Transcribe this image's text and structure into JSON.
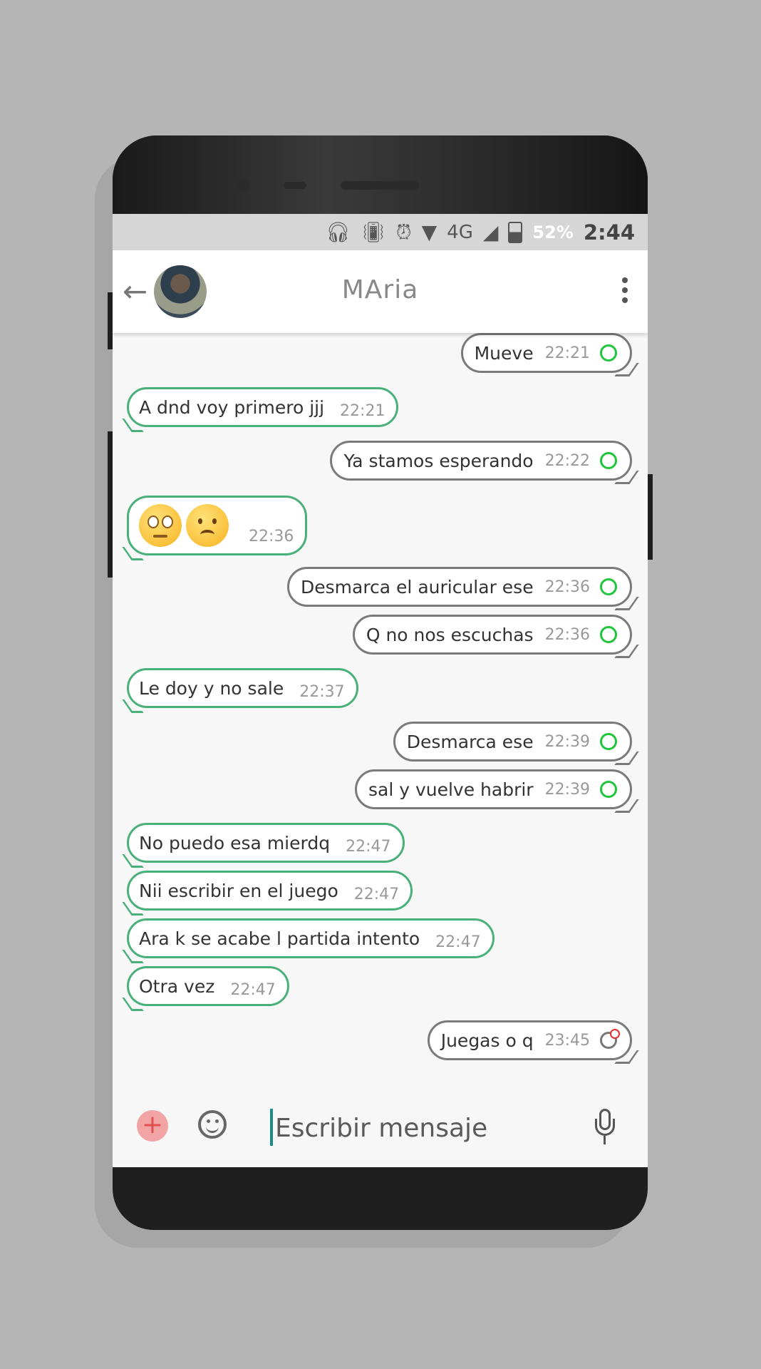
{
  "statusbar": {
    "network": "4G",
    "battery": "52%",
    "time": "2:44"
  },
  "header": {
    "contact_name": "MAria"
  },
  "messages": [
    {
      "dir": "out",
      "text": "Mueve",
      "time": "22:21",
      "status": "sent"
    },
    {
      "dir": "in",
      "text": "A dnd voy primero jjj",
      "time": "22:21"
    },
    {
      "dir": "out",
      "text": "Ya stamos esperando",
      "time": "22:22",
      "status": "sent"
    },
    {
      "dir": "in",
      "text": "",
      "emoji": [
        "eye-roll-emoji",
        "frowning-face-emoji"
      ],
      "time": "22:36"
    },
    {
      "dir": "out",
      "text": "Desmarca el auricular ese",
      "time": "22:36",
      "status": "sent"
    },
    {
      "dir": "out",
      "text": "Q no nos escuchas",
      "time": "22:36",
      "status": "sent"
    },
    {
      "dir": "in",
      "text": "Le doy y no sale",
      "time": "22:37"
    },
    {
      "dir": "out",
      "text": "Desmarca ese",
      "time": "22:39",
      "status": "sent"
    },
    {
      "dir": "out",
      "text": "sal y vuelve habrir",
      "time": "22:39",
      "status": "sent"
    },
    {
      "dir": "in",
      "text": "No puedo esa mierdq",
      "time": "22:47"
    },
    {
      "dir": "in",
      "text": "Nii escribir en el juego",
      "time": "22:47"
    },
    {
      "dir": "in",
      "text": "Ara k se acabe l partida intento",
      "time": "22:47"
    },
    {
      "dir": "in",
      "text": "Otra vez",
      "time": "22:47"
    },
    {
      "dir": "out",
      "text": "Juegas o q",
      "time": "23:45",
      "status": "pending"
    }
  ],
  "composer": {
    "placeholder": "Escribir mensaje"
  },
  "colors": {
    "incoming_border": "#49b07a",
    "outgoing_border": "#7a7a7a",
    "delivered_ring": "#1fc53b",
    "pending_dot": "#e53030",
    "attach_button": "#f2a3a3"
  }
}
